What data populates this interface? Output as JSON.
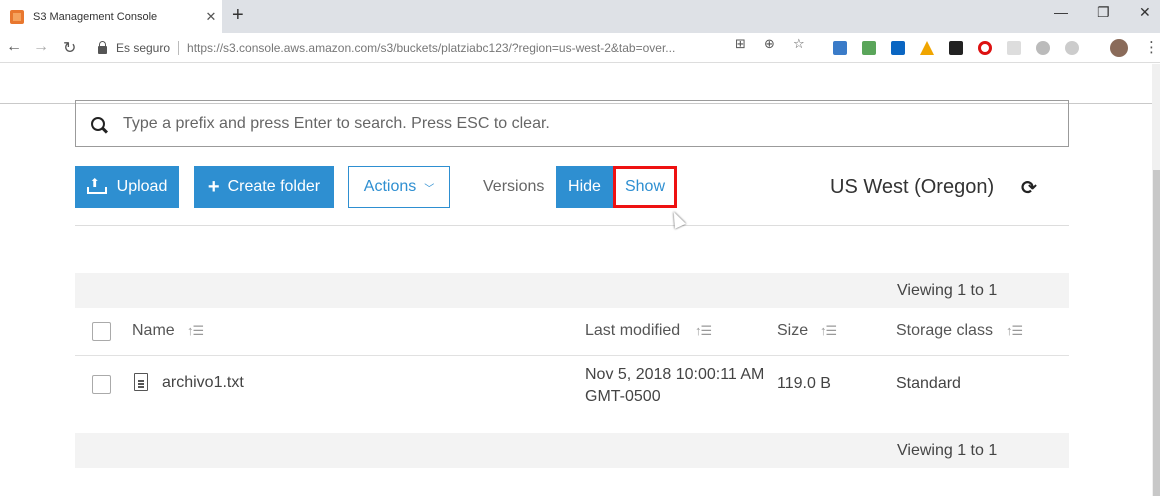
{
  "browser": {
    "tab_title": "S3 Management Console",
    "tab_close": "✕",
    "new_tab": "+",
    "secure_label": "Es seguro",
    "url": "https://s3.console.aws.amazon.com/s3/buckets/platziabc123/?region=us-west-2&tab=over...",
    "window_controls": {
      "minimize": "—",
      "restore": "❐",
      "close": "✕"
    },
    "nav": {
      "back": "←",
      "forward": "→",
      "reload": "↻"
    }
  },
  "search": {
    "placeholder": "Type a prefix and press Enter to search. Press ESC to clear."
  },
  "toolbar": {
    "upload_label": "Upload",
    "create_folder_label": "Create folder",
    "actions_label": "Actions",
    "versions_label": "Versions",
    "hide_label": "Hide",
    "show_label": "Show",
    "region": "US West (Oregon)"
  },
  "table": {
    "viewing_top": "Viewing 1 to 1",
    "viewing_bottom": "Viewing 1 to 1",
    "columns": {
      "name": "Name",
      "last_modified": "Last modified",
      "size": "Size",
      "storage_class": "Storage class"
    },
    "rows": [
      {
        "name": "archivo1.txt",
        "last_modified_line1": "Nov 5, 2018 10:00:11 AM",
        "last_modified_line2": "GMT-0500",
        "size": "119.0 B",
        "storage_class": "Standard"
      }
    ]
  },
  "colors": {
    "accent": "#2e8fd1",
    "highlight": "#ee1111"
  }
}
